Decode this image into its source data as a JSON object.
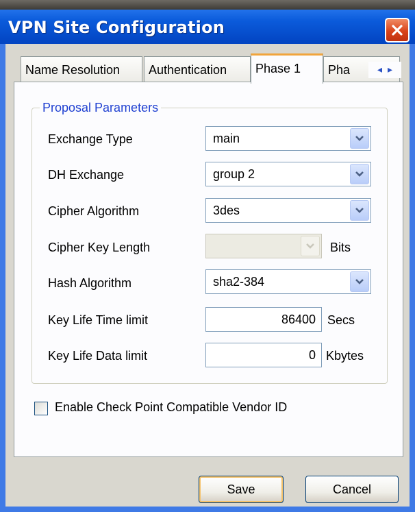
{
  "window": {
    "title": "VPN Site Configuration",
    "close_icon": "close-icon"
  },
  "tabs": [
    {
      "label": "Name Resolution",
      "active": false
    },
    {
      "label": "Authentication",
      "active": false
    },
    {
      "label": "Phase 1",
      "active": true
    },
    {
      "label": "Pha",
      "active": false
    }
  ],
  "tab_scroll": {
    "left": "◂",
    "right": "▸"
  },
  "group": {
    "title": "Proposal Parameters",
    "fields": {
      "exchange_type": {
        "label": "Exchange Type",
        "value": "main"
      },
      "dh_exchange": {
        "label": "DH Exchange",
        "value": "group 2"
      },
      "cipher_algorithm": {
        "label": "Cipher Algorithm",
        "value": "3des"
      },
      "cipher_key_length": {
        "label": "Cipher Key Length",
        "value": "",
        "unit": "Bits",
        "disabled": true
      },
      "hash_algorithm": {
        "label": "Hash Algorithm",
        "value": "sha2-384"
      },
      "key_life_time": {
        "label": "Key Life Time limit",
        "value": "86400",
        "unit": "Secs"
      },
      "key_life_data": {
        "label": "Key Life Data limit",
        "value": "0",
        "unit": "Kbytes"
      }
    }
  },
  "checkbox": {
    "label": "Enable Check Point Compatible Vendor ID",
    "checked": false
  },
  "buttons": {
    "save": "Save",
    "cancel": "Cancel"
  },
  "colors": {
    "title_bar": "#0b5bdb",
    "group_title": "#1e3fd1",
    "close": "#d9431a"
  }
}
